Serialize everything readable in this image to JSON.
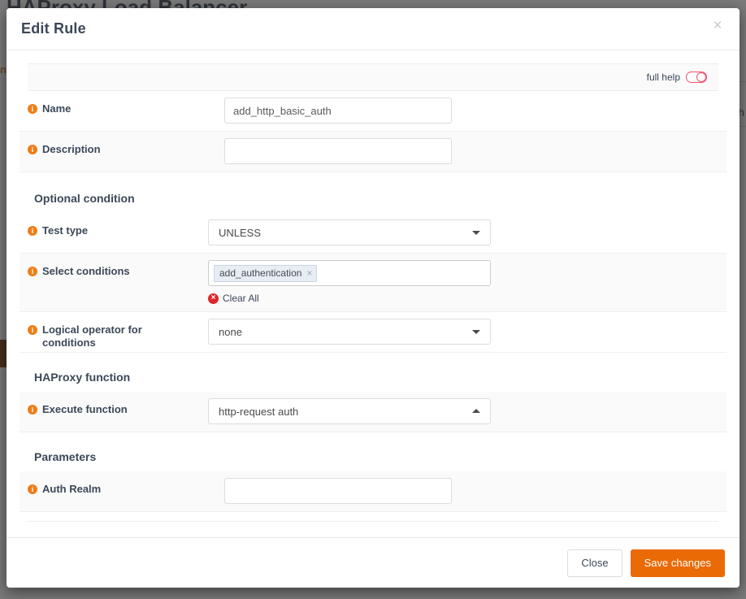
{
  "background": {
    "page_title": "HAProxy Load Balancer",
    "left_fragment": "nt",
    "right_fragment": "ch"
  },
  "modal": {
    "title": "Edit Rule",
    "close_label": "×",
    "help": {
      "label": "full help",
      "toggle_state": "off",
      "accent_color": "#f0506e"
    },
    "fields": [
      {
        "id": "name",
        "label": "Name",
        "type": "text",
        "value": "add_http_basic_auth",
        "placeholder": ""
      },
      {
        "id": "description",
        "label": "Description",
        "type": "text",
        "value": "",
        "placeholder": ""
      }
    ],
    "sections": [
      {
        "id": "optional-condition",
        "heading": "Optional condition",
        "fields": [
          {
            "id": "test-type",
            "label": "Test type",
            "type": "select",
            "value": "UNLESS",
            "caret": "down"
          },
          {
            "id": "select-conditions",
            "label": "Select conditions",
            "type": "tags",
            "tags": [
              {
                "label": "add_authentication",
                "remove": "×"
              }
            ],
            "clear_all_label": "Clear All"
          },
          {
            "id": "logical-operator",
            "label": "Logical operator for conditions",
            "type": "select",
            "value": "none",
            "caret": "down"
          }
        ]
      },
      {
        "id": "haproxy-function",
        "heading": "HAProxy function",
        "fields": [
          {
            "id": "execute-function",
            "label": "Execute function",
            "type": "select",
            "value": "http-request auth",
            "caret": "up"
          }
        ]
      },
      {
        "id": "parameters",
        "heading": "Parameters",
        "fields": [
          {
            "id": "auth-realm",
            "label": "Auth Realm",
            "type": "text",
            "value": "",
            "placeholder": ""
          }
        ]
      }
    ],
    "footer": {
      "close_label": "Close",
      "save_label": "Save changes",
      "save_color": "#ea6a06"
    }
  }
}
